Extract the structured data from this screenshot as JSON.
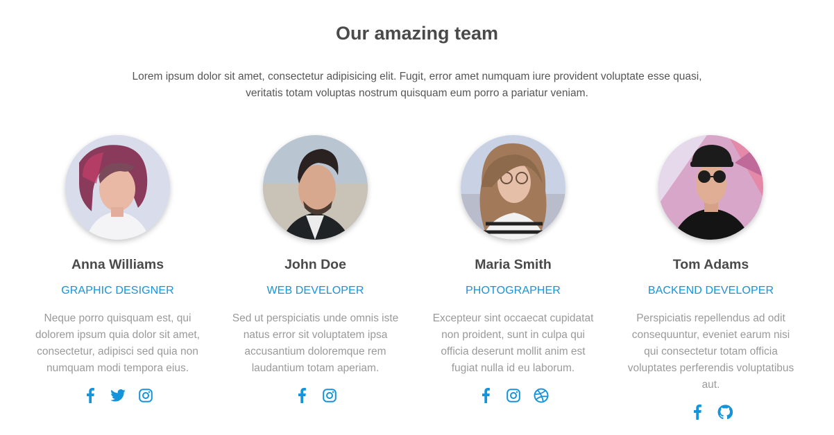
{
  "section": {
    "title": "Our amazing team",
    "intro": "Lorem ipsum dolor sit amet, consectetur adipisicing elit. Fugit, error amet numquam iure provident voluptate esse quasi, veritatis totam voluptas nostrum quisquam eum porro a pariatur veniam."
  },
  "accent_color": "#1593db",
  "members": [
    {
      "name": "Anna Williams",
      "role": "GRAPHIC DESIGNER",
      "bio": "Neque porro quisquam est, qui dolorem ipsum quia dolor sit amet, consectetur, adipisci sed quia non numquam modi tempora eius.",
      "photo": "portrait-woman-short-red-hair",
      "socials": [
        "facebook-icon",
        "twitter-icon",
        "instagram-icon"
      ]
    },
    {
      "name": "John Doe",
      "role": "WEB DEVELOPER",
      "bio": "Sed ut perspiciatis unde omnis iste natus error sit voluptatem ipsa accusantium doloremque rem laudantium totam aperiam.",
      "photo": "portrait-man-dark-hair",
      "socials": [
        "facebook-icon",
        "instagram-icon"
      ]
    },
    {
      "name": "Maria Smith",
      "role": "PHOTOGRAPHER",
      "bio": "Excepteur sint occaecat cupidatat non proident, sunt in culpa qui officia deserunt mollit anim est fugiat nulla id eu laborum.",
      "photo": "portrait-woman-glasses-long-hair",
      "socials": [
        "facebook-icon",
        "instagram-icon",
        "dribbble-icon"
      ]
    },
    {
      "name": "Tom Adams",
      "role": "BACKEND DEVELOPER",
      "bio": "Perspiciatis repellendus ad odit consequuntur, eveniet earum nisi qui consectetur totam officia voluptates perferendis voluptatibus aut.",
      "photo": "portrait-man-cap-sunglasses",
      "socials": [
        "facebook-icon",
        "github-icon"
      ]
    }
  ]
}
